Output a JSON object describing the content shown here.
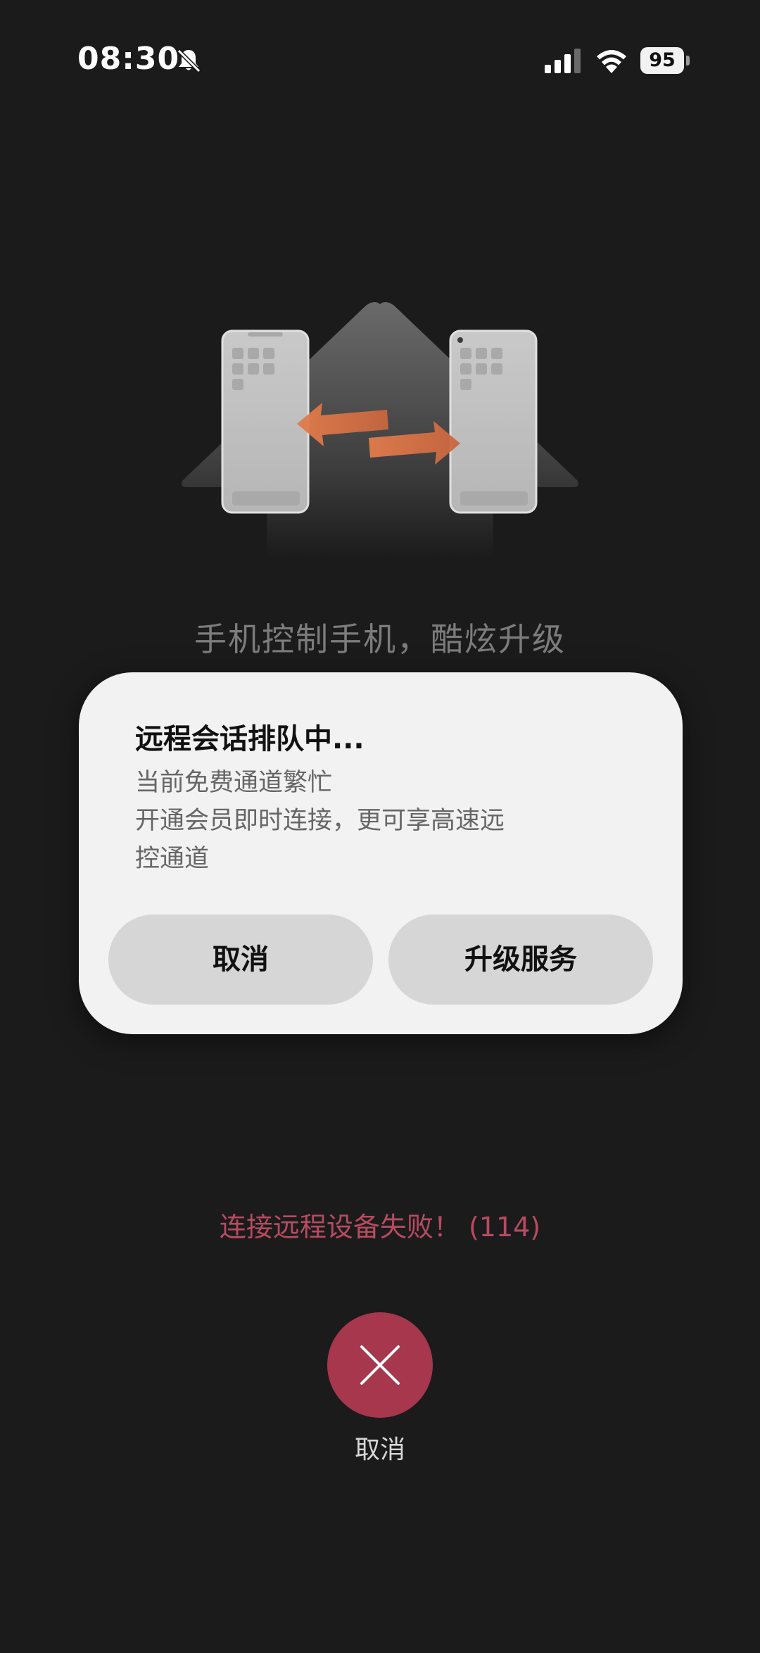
{
  "status_bar": {
    "time": "08:30",
    "battery": "95",
    "icons": [
      "bell-slash-icon",
      "cellular-signal-icon",
      "wifi-icon",
      "battery-icon"
    ]
  },
  "hero": {
    "title": "手机控制手机，酷炫升级"
  },
  "dialog": {
    "title": "远程会话排队中...",
    "message_lines": [
      "当前免费通道繁忙",
      "开通会员即时连接，更可享高速远",
      "控通道"
    ],
    "cancel_label": "取消",
    "upgrade_label": "升级服务"
  },
  "error_message": "连接远程设备失败！ (114)",
  "cancel_button": {
    "label": "取消",
    "icon": "close-icon"
  },
  "colors": {
    "background": "#1b1b1c",
    "dialog_background": "#f2f2f2",
    "dialog_button": "#d6d6d6",
    "error_text": "#b74b60",
    "cancel_circle": "#a6374d",
    "arrow": "#e07a4a"
  }
}
